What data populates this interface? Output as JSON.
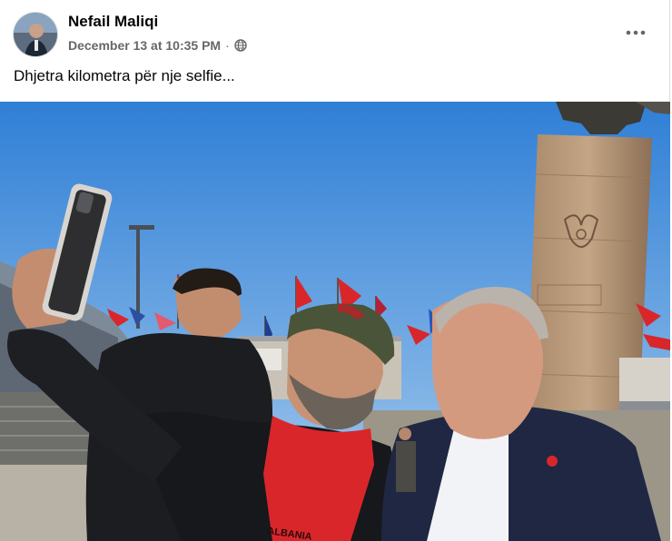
{
  "post": {
    "author_name": "Nefail Maliqi",
    "timestamp": "December 13 at 10:35 PM",
    "separator": "·",
    "privacy_icon": "globe-icon",
    "more_icon": "more-horizontal-icon",
    "caption": "Dhjetra kilometra për nje selfie..."
  },
  "photo": {
    "scarf_text": "ALBANIA"
  },
  "colors": {
    "name_text": "#050505",
    "meta_text": "#65676b",
    "sky": "#4a90d9",
    "albanian_red": "#d9262b"
  }
}
